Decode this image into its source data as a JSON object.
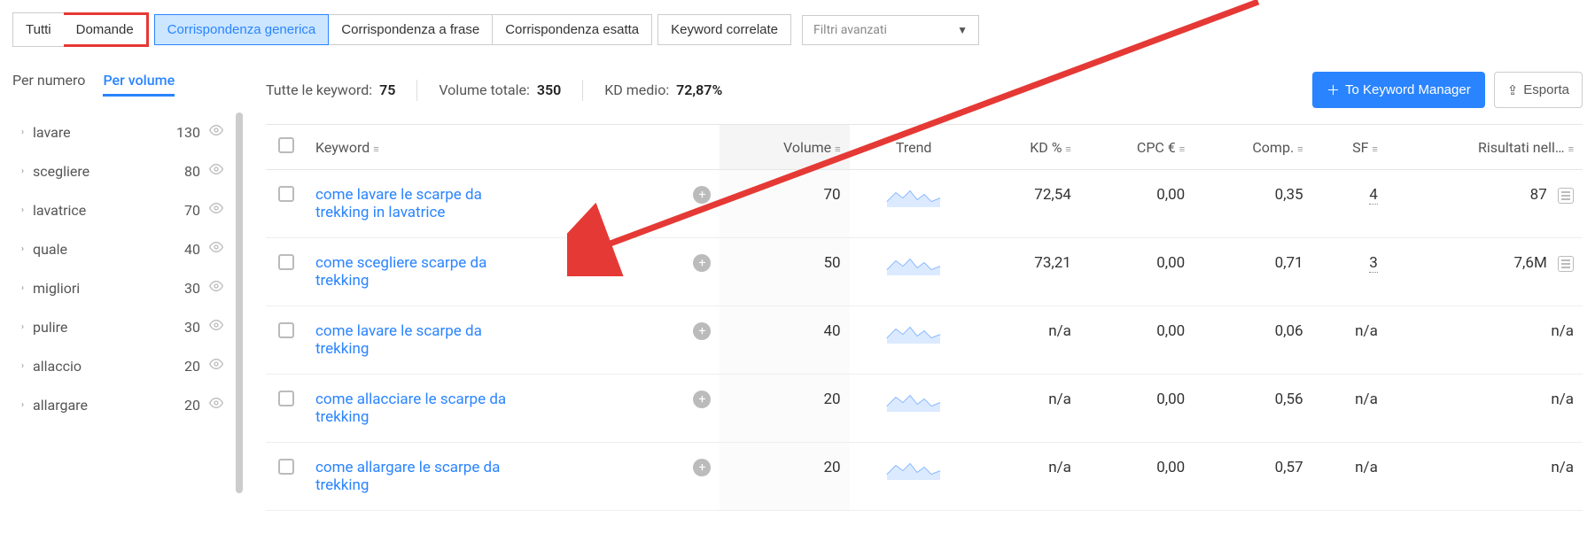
{
  "filters": {
    "tutti": "Tutti",
    "domande": "Domande",
    "generica": "Corrispondenza generica",
    "frase": "Corrispondenza a frase",
    "esatta": "Corrispondenza esatta",
    "correlate": "Keyword correlate",
    "advanced_placeholder": "Filtri avanzati"
  },
  "sidebar": {
    "tabs": {
      "per_numero": "Per numero",
      "per_volume": "Per volume"
    },
    "groups": [
      {
        "label": "lavare",
        "count": "130"
      },
      {
        "label": "scegliere",
        "count": "80"
      },
      {
        "label": "lavatrice",
        "count": "70"
      },
      {
        "label": "quale",
        "count": "40"
      },
      {
        "label": "migliori",
        "count": "30"
      },
      {
        "label": "pulire",
        "count": "30"
      },
      {
        "label": "allaccio",
        "count": "20"
      },
      {
        "label": "allargare",
        "count": "20"
      }
    ]
  },
  "stats": {
    "all_kw_label": "Tutte le keyword:",
    "all_kw_value": "75",
    "volume_label": "Volume totale:",
    "volume_value": "350",
    "kd_label": "KD medio:",
    "kd_value": "72,87%"
  },
  "actions": {
    "to_manager": "To Keyword Manager",
    "export": "Esporta"
  },
  "columns": {
    "keyword": "Keyword",
    "volume": "Volume",
    "trend": "Trend",
    "kd": "KD %",
    "cpc": "CPC €",
    "comp": "Comp.",
    "sf": "SF",
    "results": "Risultati nell…"
  },
  "rows": [
    {
      "keyword": "come lavare le scarpe da trekking in lavatrice",
      "volume": "70",
      "kd": "72,54",
      "cpc": "0,00",
      "comp": "0,35",
      "sf": "4",
      "results": "87",
      "has_serp": true
    },
    {
      "keyword": "come scegliere scarpe da trekking",
      "volume": "50",
      "kd": "73,21",
      "cpc": "0,00",
      "comp": "0,71",
      "sf": "3",
      "results": "7,6M",
      "has_serp": true
    },
    {
      "keyword": "come lavare le scarpe da trekking",
      "volume": "40",
      "kd": "n/a",
      "cpc": "0,00",
      "comp": "0,06",
      "sf": "n/a",
      "results": "n/a",
      "has_serp": false
    },
    {
      "keyword": "come allacciare le scarpe da trekking",
      "volume": "20",
      "kd": "n/a",
      "cpc": "0,00",
      "comp": "0,56",
      "sf": "n/a",
      "results": "n/a",
      "has_serp": false
    },
    {
      "keyword": "come allargare le scarpe da trekking",
      "volume": "20",
      "kd": "n/a",
      "cpc": "0,00",
      "comp": "0,57",
      "sf": "n/a",
      "results": "n/a",
      "has_serp": false
    }
  ]
}
